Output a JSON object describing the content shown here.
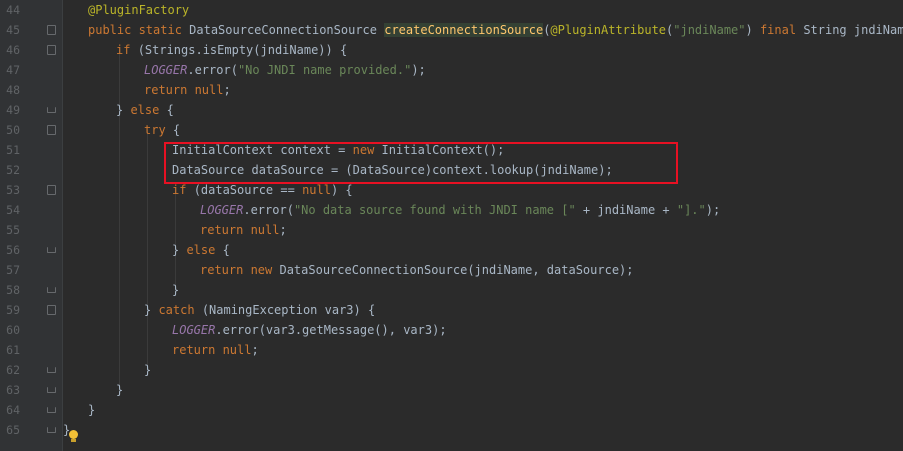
{
  "editor": {
    "line_numbers": [
      "44",
      "45",
      "46",
      "47",
      "48",
      "49",
      "50",
      "51",
      "52",
      "53",
      "54",
      "55",
      "56",
      "57",
      "58",
      "59",
      "60",
      "61",
      "62",
      "63",
      "64",
      "65"
    ],
    "lines": {
      "l44": {
        "ann": "@PluginFactory"
      },
      "l45": {
        "kw1": "public static ",
        "t1": "DataSourceConnectionSource ",
        "method": "createConnectionSource",
        "t2": "(",
        "ann": "@PluginAttribute",
        "t3": "(",
        "str": "\"jndiName\"",
        "t4": ") ",
        "kw2": "final ",
        "t5": "String jndiName) {"
      },
      "l46": {
        "kw": "if ",
        "t": "(Strings.isEmpty(jndiName)) {"
      },
      "l47": {
        "const": "LOGGER",
        "t1": ".error(",
        "str": "\"No JNDI name provided.\"",
        "t2": ");"
      },
      "l48": {
        "kw": "return null",
        "t": ";"
      },
      "l49": {
        "t1": "} ",
        "kw": "else ",
        "t2": "{"
      },
      "l50": {
        "kw": "try ",
        "t": "{"
      },
      "l51": {
        "t1": "InitialContext context = ",
        "kw": "new ",
        "t2": "InitialContext();"
      },
      "l52": {
        "t": "DataSource dataSource = (DataSource)context.lookup(jndiName);"
      },
      "l53": {
        "kw1": "if ",
        "t1": "(dataSource == ",
        "kw2": "null",
        "t2": ") {"
      },
      "l54": {
        "const": "LOGGER",
        "t1": ".error(",
        "str1": "\"No data source found with JNDI name [\"",
        "t2": " + jndiName + ",
        "str2": "\"].\"",
        "t3": ");"
      },
      "l55": {
        "kw": "return null",
        "t": ";"
      },
      "l56": {
        "t1": "} ",
        "kw": "else ",
        "t2": "{"
      },
      "l57": {
        "kw": "return new ",
        "t": "DataSourceConnectionSource(jndiName, dataSource);"
      },
      "l58": {
        "t": "}"
      },
      "l59": {
        "t1": "} ",
        "kw": "catch ",
        "t2": "(NamingException var3) {"
      },
      "l60": {
        "const": "LOGGER",
        "t": ".error(var3.getMessage(), var3);"
      },
      "l61": {
        "kw": "return null",
        "t": ";"
      },
      "l62": {
        "t": "}"
      },
      "l63": {
        "t": "}"
      },
      "l64": {
        "t": "}"
      },
      "l65": {
        "t": "}"
      }
    },
    "colors": {
      "background": "#2b2b2b",
      "gutter": "#313335",
      "keyword": "#cc7832",
      "string": "#6a8759",
      "annotation": "#bbb529",
      "constant": "#9876aa",
      "method_highlight": "#344134",
      "highlight_box": "#e81123"
    },
    "icons": {
      "intention": "lightbulb-icon",
      "fold": "fold-marker-icon"
    }
  }
}
